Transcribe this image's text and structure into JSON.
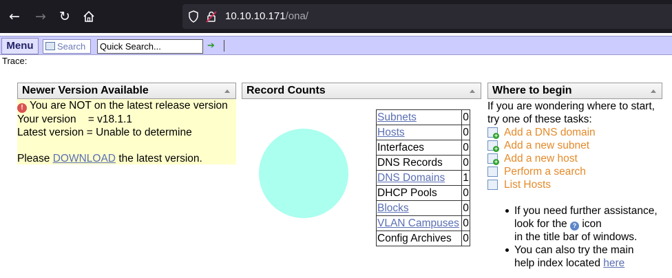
{
  "browser": {
    "url_host": "10.10.10.171",
    "url_path": "/ona/"
  },
  "menubar": {
    "menu_label": "Menu",
    "search_label": "Search",
    "quick_search_value": "Quick Search...",
    "trace_label": "Trace:"
  },
  "news_panel": {
    "title": "Newer Version Available",
    "warning": "You are NOT on the latest release version",
    "your_version": "Your version    = v18.1.1",
    "latest_version": "Latest version = Unable to determine",
    "please": "Please",
    "download_link": "DOWNLOAD",
    "after_link": "the latest version."
  },
  "record_counts": {
    "title": "Record Counts",
    "rows": [
      {
        "label": "Subnets",
        "value": "0",
        "link": true
      },
      {
        "label": "Hosts",
        "value": "0",
        "link": true
      },
      {
        "label": "Interfaces",
        "value": "0",
        "link": false
      },
      {
        "label": "DNS Records",
        "value": "0",
        "link": false
      },
      {
        "label": "DNS Domains",
        "value": "1",
        "link": true
      },
      {
        "label": "DHCP Pools",
        "value": "0",
        "link": false
      },
      {
        "label": "Blocks",
        "value": "0",
        "link": true
      },
      {
        "label": "VLAN Campuses",
        "value": "0",
        "link": true
      },
      {
        "label": "Config Archives",
        "value": "0",
        "link": false
      }
    ],
    "pie_color": "#aaffee"
  },
  "where_panel": {
    "title": "Where to begin",
    "intro_line1": "If you are wondering where to start,",
    "intro_line2": "try one of these tasks:",
    "tasks": [
      {
        "label": "Add a DNS domain",
        "icon": "add-domain-icon"
      },
      {
        "label": "Add a new subnet",
        "icon": "add-subnet-icon"
      },
      {
        "label": "Add a new host",
        "icon": "add-host-icon"
      },
      {
        "label": "Perform a search",
        "icon": "search-icon"
      },
      {
        "label": "List Hosts",
        "icon": "list-icon"
      }
    ],
    "help1_a": "If you need further assistance,",
    "help1_b": "look for the",
    "help1_c": "icon",
    "help1_d": "in the title bar of windows.",
    "help2_a": "You can also try the main",
    "help2_b": "help index located",
    "help2_link": "here"
  }
}
